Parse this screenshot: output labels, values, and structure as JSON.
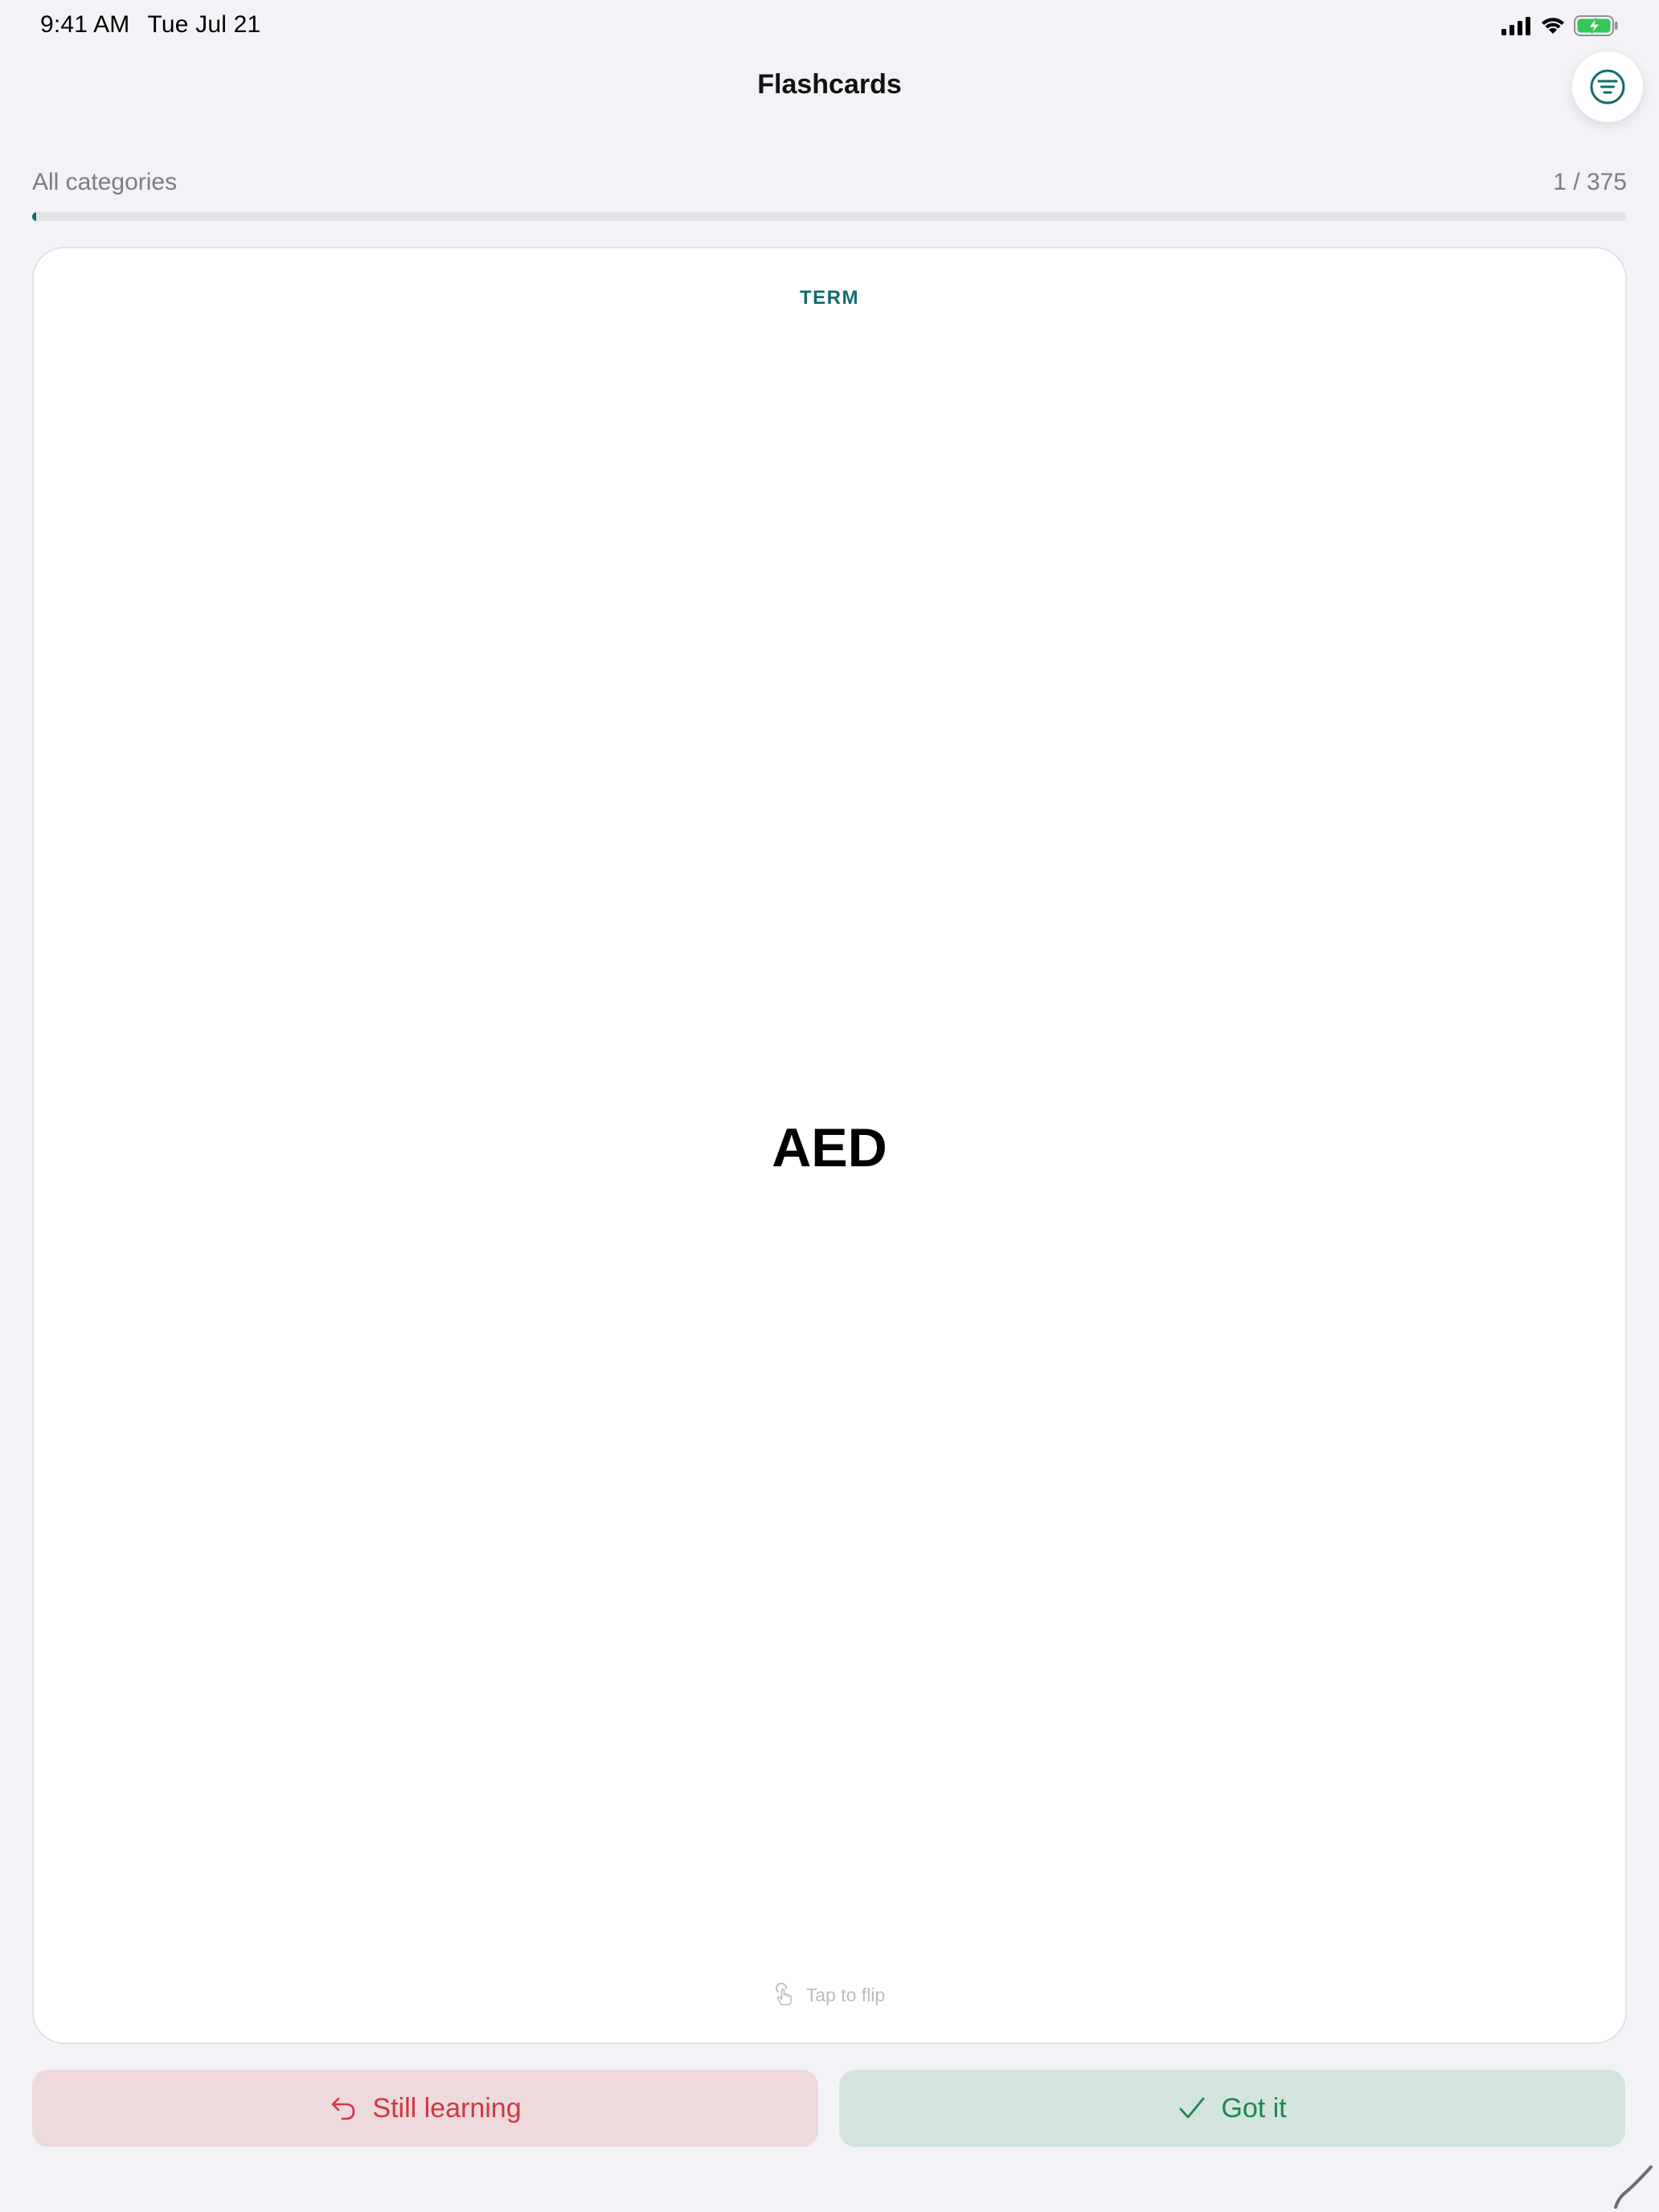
{
  "status_bar": {
    "time": "9:41 AM",
    "date": "Tue Jul 21"
  },
  "nav": {
    "title": "Flashcards",
    "filter_icon": "filter-lines-icon"
  },
  "progress": {
    "category": "All categories",
    "counter": "1 / 375",
    "fraction": 0.0027
  },
  "card": {
    "side_label": "TERM",
    "term": "AED",
    "hint": "Tap to flip",
    "hint_icon": "tap-hand-icon"
  },
  "actions": {
    "still_learning": {
      "label": "Still learning",
      "icon": "undo-arrow-icon"
    },
    "got_it": {
      "label": "Got it",
      "icon": "checkmark-icon"
    }
  },
  "colors": {
    "accent": "#136b6b",
    "still_learning": "#d0373f",
    "got_it": "#1a8a4d",
    "background": "#f2f2f7"
  }
}
